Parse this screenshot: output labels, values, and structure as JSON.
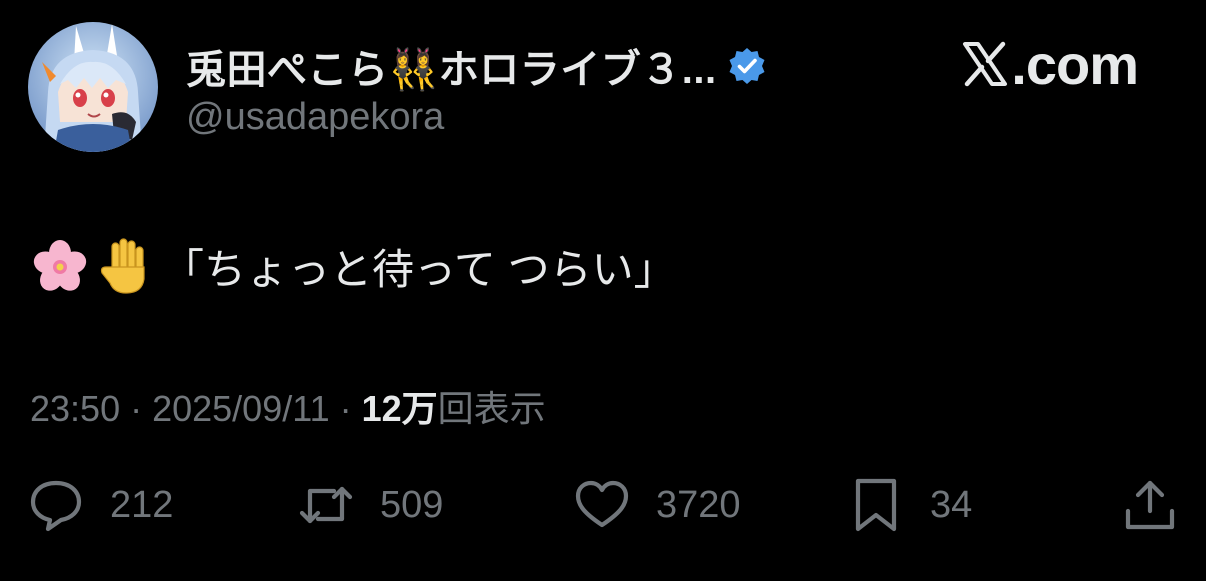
{
  "header": {
    "display_name": "兎田ぺこら👯‍♀️ホロライブ３...",
    "handle": "@usadapekora",
    "brand": ".com",
    "verified_color": "#4a99e9",
    "avatar_icon": "anime-girl-avatar"
  },
  "tweet": {
    "emojis": [
      "cherry-blossom-emoji",
      "raised-hand-emoji"
    ],
    "text": "「ちょっと待って つらい」"
  },
  "meta": {
    "time": "23:50",
    "sep1": " · ",
    "date": "2025/09/11",
    "sep2": " · ",
    "views_count": "12万",
    "views_label": "回表示"
  },
  "actions": {
    "replies": "212",
    "retweets": "509",
    "likes": "3720",
    "bookmarks": "34"
  },
  "colors": {
    "background": "#000000",
    "text_primary": "#e7e9ea",
    "text_secondary": "#71767b"
  }
}
